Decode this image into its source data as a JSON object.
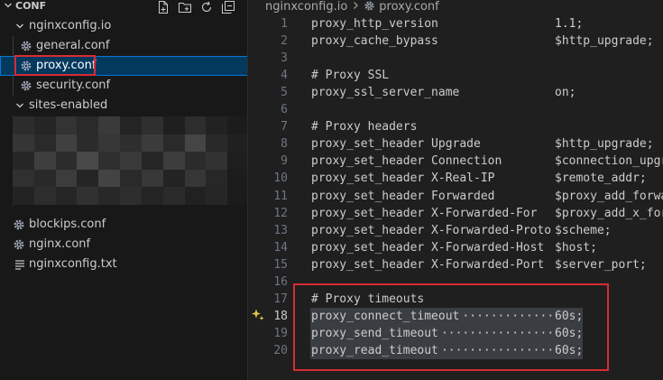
{
  "sidebar": {
    "header_title": "CONF",
    "actions": [
      "new-file-icon",
      "new-folder-icon",
      "refresh-icon",
      "collapse-all-icon"
    ],
    "tree": [
      {
        "label": "nginxconfig.io",
        "kind": "folder",
        "expanded": true,
        "level": 1
      },
      {
        "label": "general.conf",
        "kind": "file",
        "level": 2
      },
      {
        "label": "proxy.conf",
        "kind": "file",
        "level": 2,
        "selected": true
      },
      {
        "label": "security.conf",
        "kind": "file",
        "level": 2
      },
      {
        "label": "sites-enabled",
        "kind": "folder",
        "expanded": true,
        "level": 1
      },
      {
        "label": "blockips.conf",
        "kind": "file",
        "level": 1
      },
      {
        "label": "nginx.conf",
        "kind": "file",
        "level": 1
      },
      {
        "label": "nginxconfig.txt",
        "kind": "text",
        "level": 1
      }
    ]
  },
  "editor": {
    "breadcrumb": [
      "nginxconfig.io",
      "proxy.conf"
    ],
    "lines": [
      {
        "n": "1",
        "key": "proxy_http_version",
        "val": "1.1;",
        "type": "val"
      },
      {
        "n": "2",
        "key": "proxy_cache_bypass",
        "val": "$http_upgrade;",
        "type": "var"
      },
      {
        "n": "3",
        "type": "blank"
      },
      {
        "n": "4",
        "comment": "# Proxy SSL",
        "type": "comment"
      },
      {
        "n": "5",
        "key": "proxy_ssl_server_name",
        "val": "on;",
        "type": "val"
      },
      {
        "n": "6",
        "type": "blank"
      },
      {
        "n": "7",
        "comment": "# Proxy headers",
        "type": "comment"
      },
      {
        "n": "8",
        "key": "proxy_set_header Upgrade",
        "val": "$http_upgrade;",
        "type": "var"
      },
      {
        "n": "9",
        "key": "proxy_set_header Connection",
        "val": "$connection_upgr",
        "type": "var"
      },
      {
        "n": "10",
        "key": "proxy_set_header X-Real-IP",
        "val": "$remote_addr;",
        "type": "var"
      },
      {
        "n": "11",
        "key": "proxy_set_header Forwarded",
        "val": "$proxy_add_forwa",
        "type": "var"
      },
      {
        "n": "12",
        "key": "proxy_set_header X-Forwarded-For",
        "val": "$proxy_add_x_for",
        "type": "var"
      },
      {
        "n": "13",
        "key": "proxy_set_header X-Forwarded-Proto",
        "val": "$scheme;",
        "type": "var"
      },
      {
        "n": "14",
        "key": "proxy_set_header X-Forwarded-Host",
        "val": "$host;",
        "type": "var"
      },
      {
        "n": "15",
        "key": "proxy_set_header X-Forwarded-Port",
        "val": "$server_port;",
        "type": "var"
      },
      {
        "n": "16",
        "type": "blank"
      },
      {
        "n": "17",
        "comment": "# Proxy timeouts",
        "type": "comment"
      },
      {
        "n": "18",
        "key": "proxy_connect_timeout",
        "val": "60s;",
        "type": "val",
        "selected": true,
        "active": true
      },
      {
        "n": "19",
        "key": "proxy_send_timeout",
        "val": "60s;",
        "type": "val",
        "selected": true
      },
      {
        "n": "20",
        "key": "proxy_read_timeout",
        "val": "60s;",
        "type": "val",
        "selected": true
      }
    ]
  },
  "colors": {
    "selection": "#04395e",
    "highlight_box": "#d92b33",
    "comment": "#6a9955",
    "variable": "#d7ba7d"
  }
}
